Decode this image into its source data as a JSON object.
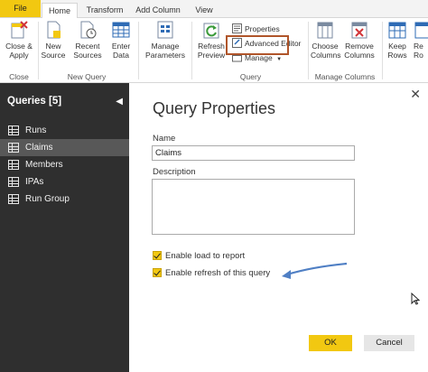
{
  "tabs": [
    "File",
    "Home",
    "Transform",
    "Add Column",
    "View"
  ],
  "ribbon": {
    "close_apply": "Close &\nApply",
    "new_source": "New\nSource",
    "recent_sources": "Recent\nSources",
    "enter_data": "Enter\nData",
    "manage_parameters": "Manage\nParameters",
    "refresh_preview": "Refresh\nPreview",
    "properties": "Properties",
    "advanced_editor": "Advanced Editor",
    "manage": "Manage",
    "choose_columns": "Choose\nColumns",
    "remove_columns": "Remove\nColumns",
    "keep_rows": "Keep\nRows",
    "remove_rows_partial": "Re\nRo",
    "groups": {
      "close": "Close",
      "new_query": "New Query",
      "query": "Query",
      "manage_columns": "Manage Columns"
    }
  },
  "queries": {
    "header": "Queries [5]",
    "items": [
      "Runs",
      "Claims",
      "Members",
      "IPAs",
      "Run Group"
    ],
    "selected": "Claims"
  },
  "dialog": {
    "title": "Query Properties",
    "name_label": "Name",
    "name_value": "Claims",
    "description_label": "Description",
    "description_value": "",
    "enable_load": "Enable load to report",
    "enable_refresh": "Enable refresh of this query",
    "ok": "OK",
    "cancel": "Cancel"
  },
  "colors": {
    "accent": "#f2c811",
    "left_panel": "#2f2f2f",
    "annotation_arrow": "#4f7fc4",
    "highlight_box": "#b0552a"
  }
}
